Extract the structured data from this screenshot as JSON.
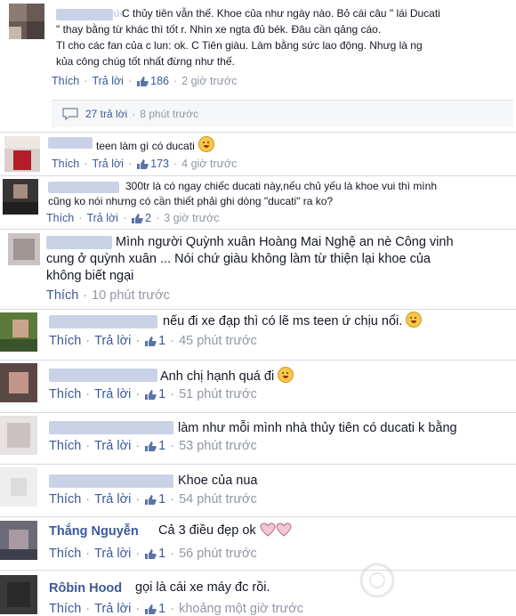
{
  "comments": [
    {
      "name": "Trúc",
      "lines": [
        "C thủy tiên vẫn thế. Khoe của như ngày nào. Bỏ cái câu \" lái Ducati",
        "\" thay bằng từ khác thì tốt r. Nhìn xe ngta đủ bék. Đâu cần qảng cáo.",
        "Tl cho các fan của c lun: ok. C Tiên giàu. Làm bằng sức lao động. Nhưg là ng",
        "kủa công chúg tốt nhất đừng như thế."
      ],
      "like": "Thích",
      "reply": "Trả lời",
      "likes": "186",
      "time": "2 giờ trước",
      "replies": {
        "count": "27 trả lời",
        "time": "8 phút trước"
      }
    },
    {
      "name": "",
      "lines": [
        "teen làm gì có ducati"
      ],
      "like": "Thích",
      "reply": "Trả lời",
      "likes": "173",
      "time": "4 giờ trước"
    },
    {
      "name": "",
      "lines": [
        "300tr là có ngay chiếc ducati này,nếu chủ yếu là khoe vui thì mình",
        "cũng ko nói nhưng có cần thiết phải ghi dòng \"ducati\" ra ko?"
      ],
      "like": "Thích",
      "reply": "Trả lời",
      "likes": "2",
      "time": "3 giờ trước"
    },
    {
      "name": "",
      "lines": [
        "Mình người Quỳnh xuân Hoàng Mai Nghệ an nè Công vinh",
        "cung ở quỳnh xuân ... Nói chứ giàu không làm từ thiện lại khoe của",
        "không biết ngại"
      ],
      "like": "Thích",
      "time": "10 phút trước"
    },
    {
      "name": "",
      "lines": [
        "nếu đi xe đạp thì có lẽ ms teen ứ chịu nổi."
      ],
      "like": "Thích",
      "reply": "Trả lời",
      "likes": "1",
      "time": "45 phút trước"
    },
    {
      "name": "",
      "lines": [
        "Anh chị hạnh quá đi"
      ],
      "like": "Thích",
      "reply": "Trả lời",
      "likes": "1",
      "time": "51 phút trước"
    },
    {
      "name": "",
      "lines": [
        "làm như mỗi mình nhà thủy tiên có ducati k bằng"
      ],
      "like": "Thích",
      "reply": "Trả lời",
      "likes": "1",
      "time": "53 phút trước"
    },
    {
      "name": "",
      "lines": [
        "Khoe của nua"
      ],
      "like": "Thích",
      "reply": "Trả lời",
      "likes": "1",
      "time": "54 phút trước"
    },
    {
      "name": "Thắng Nguyễn",
      "lines": [
        "Cả 3 điều đẹp ok"
      ],
      "like": "Thích",
      "reply": "Trả lời",
      "likes": "1",
      "time": "56 phút trước"
    },
    {
      "name": "Rôbin Hood",
      "lines": [
        "gọi là cái xe máy đc rồi."
      ],
      "like": "Thích",
      "reply": "Trả lời",
      "likes": "1",
      "time": "khoảng một giờ trước"
    }
  ],
  "colors": {
    "link": "#3b5998",
    "meta": "#9197a3",
    "text": "#141823"
  }
}
